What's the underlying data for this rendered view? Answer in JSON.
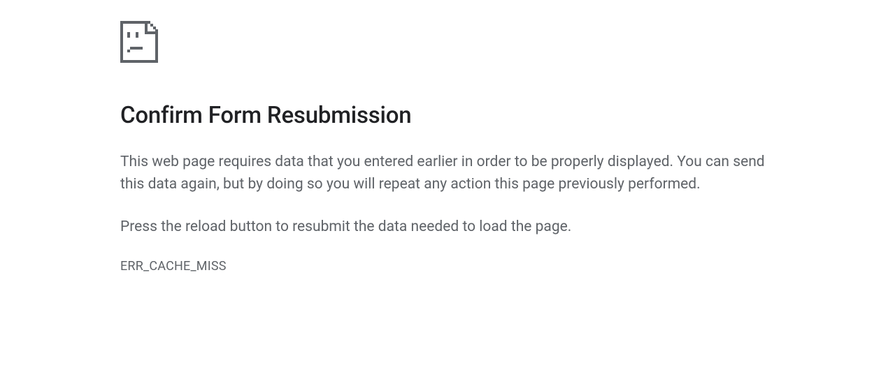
{
  "error": {
    "title": "Confirm Form Resubmission",
    "description": "This web page requires data that you entered earlier in order to be properly displayed. You can send this data again, but by doing so you will repeat any action this page previously performed.",
    "instruction": "Press the reload button to resubmit the data needed to load the page.",
    "code": "ERR_CACHE_MISS"
  }
}
